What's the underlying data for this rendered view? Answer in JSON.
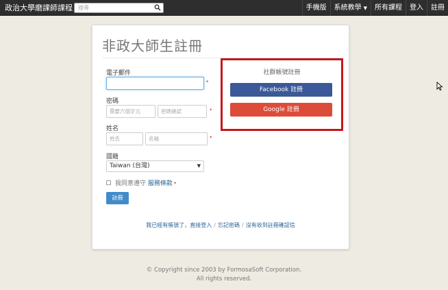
{
  "navbar": {
    "brand": "政治大學磨課師課程",
    "search_placeholder": "搜尋",
    "items": [
      {
        "label": "手機版"
      },
      {
        "label": "系統教學"
      },
      {
        "label": "所有課程"
      },
      {
        "label": "登入"
      },
      {
        "label": "註冊"
      }
    ]
  },
  "form": {
    "title": "非政大師生註冊",
    "email_label": "電子郵件",
    "email_value": "",
    "password_label": "密碼",
    "password_placeholder": "需要六個字元",
    "password_confirm_placeholder": "密碼確認",
    "name_label": "姓名",
    "last_name_placeholder": "姓氏",
    "first_name_placeholder": "名稱",
    "nationality_label": "國籍",
    "nationality_value": "Taiwan (台灣)",
    "agree_text": "我同意遵守",
    "terms_link": "服務條款",
    "register_button": "註冊",
    "required_mark": "*"
  },
  "social": {
    "title": "社群帳號註冊",
    "facebook_button": "Facebook 註冊",
    "google_button": "Google 註冊",
    "facebook_color": "#3b5998",
    "google_color": "#dd4b39",
    "highlight_color": "#c4161c"
  },
  "links": {
    "have_account": "我已經有帳號了，直接登入",
    "forgot_password": "忘記密碼",
    "no_confirmation": "沒有收到註冊確認信",
    "separator": "/"
  },
  "footer": {
    "copyright": "© Copyright since 2003 by FormosaSoft Corporation.",
    "rights": "All rights reserved."
  }
}
